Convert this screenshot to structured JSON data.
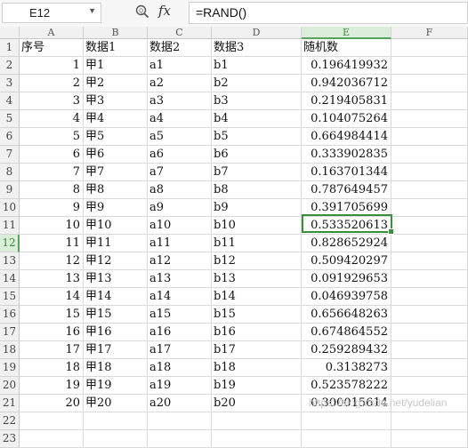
{
  "formula_bar": {
    "name_box": "E12",
    "fx_label": "fx",
    "formula": "=RAND()"
  },
  "columns": [
    "A",
    "B",
    "C",
    "D",
    "E",
    "F"
  ],
  "active_column": "E",
  "active_row": 12,
  "row_numbers": [
    "1",
    "2",
    "3",
    "4",
    "5",
    "6",
    "7",
    "8",
    "9",
    "10",
    "11",
    "12",
    "13",
    "14",
    "15",
    "16",
    "17",
    "18",
    "19",
    "20",
    "21",
    "22",
    "23"
  ],
  "header_row": [
    "序号",
    "数据1",
    "数据2",
    "数据3",
    "随机数"
  ],
  "rows": [
    [
      "1",
      "甲1",
      "a1",
      "b1",
      "0.196419932"
    ],
    [
      "2",
      "甲2",
      "a2",
      "b2",
      "0.942036712"
    ],
    [
      "3",
      "甲3",
      "a3",
      "b3",
      "0.219405831"
    ],
    [
      "4",
      "甲4",
      "a4",
      "b4",
      "0.104075264"
    ],
    [
      "5",
      "甲5",
      "a5",
      "b5",
      "0.664984414"
    ],
    [
      "6",
      "甲6",
      "a6",
      "b6",
      "0.333902835"
    ],
    [
      "7",
      "甲7",
      "a7",
      "b7",
      "0.163701344"
    ],
    [
      "8",
      "甲8",
      "a8",
      "b8",
      "0.787649457"
    ],
    [
      "9",
      "甲9",
      "a9",
      "b9",
      "0.391705699"
    ],
    [
      "10",
      "甲10",
      "a10",
      "b10",
      "0.533520613"
    ],
    [
      "11",
      "甲11",
      "a11",
      "b11",
      "0.828652924"
    ],
    [
      "12",
      "甲12",
      "a12",
      "b12",
      "0.509420297"
    ],
    [
      "13",
      "甲13",
      "a13",
      "b13",
      "0.091929653"
    ],
    [
      "14",
      "甲14",
      "a14",
      "b14",
      "0.046939758"
    ],
    [
      "15",
      "甲15",
      "a15",
      "b15",
      "0.656648263"
    ],
    [
      "16",
      "甲16",
      "a16",
      "b16",
      "0.674864552"
    ],
    [
      "17",
      "甲17",
      "a17",
      "b17",
      "0.259289432"
    ],
    [
      "18",
      "甲18",
      "a18",
      "b18",
      "0.3138273"
    ],
    [
      "19",
      "甲19",
      "a19",
      "b19",
      "0.523578222"
    ],
    [
      "20",
      "甲20",
      "a20",
      "b20",
      "0.300015614"
    ]
  ],
  "watermark": "https://blog.csdn.net/yudelian",
  "colors": {
    "selection": "#3b8f3b",
    "active_header_bg": "#dbeedb"
  }
}
